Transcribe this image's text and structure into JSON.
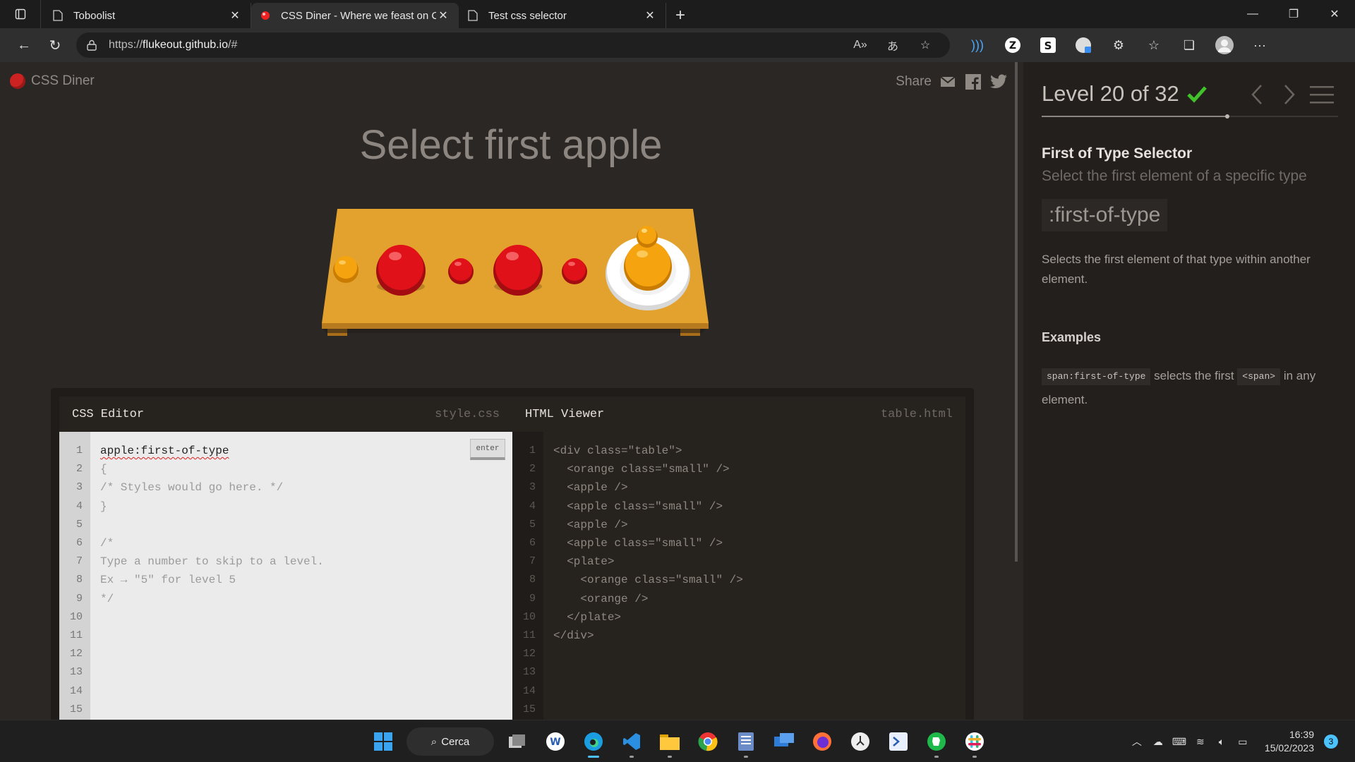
{
  "browser": {
    "tabs": [
      {
        "title": "Toboolist",
        "icon": "page-icon"
      },
      {
        "title": "CSS Diner - Where we feast on C",
        "icon": "css-diner-icon"
      },
      {
        "title": "Test css selector",
        "icon": "page-icon"
      }
    ],
    "url_prefix": "https://",
    "url_host": "flukeout.github.io",
    "url_suffix": "/#"
  },
  "page": {
    "logo": "CSS Diner",
    "share_label": "Share",
    "instruction": "Select first apple"
  },
  "editor": {
    "css_label": "CSS Editor",
    "css_file": "style.css",
    "html_label": "HTML Viewer",
    "html_file": "table.html",
    "enter_label": "enter",
    "typed_selector": "apple:first-of-type",
    "line_numbers": "1\n2\n3\n4\n5\n6\n7\n8\n9\n10\n11\n12\n13\n14\n15",
    "css_rest": "\n{\n/* Styles would go here. */\n}\n\n/*\nType a number to skip to a level.\nEx → \"5\" for level 5\n*/",
    "html_code": "<div class=\"table\">\n  <orange class=\"small\" />\n  <apple />\n  <apple class=\"small\" />\n  <apple />\n  <apple class=\"small\" />\n  <plate>\n    <orange class=\"small\" />\n    <orange />\n  </plate>\n</div>"
  },
  "sidebar": {
    "level_title": "Level 20 of 32",
    "level_current": 20,
    "level_total": 32,
    "completed": true,
    "selector_name": "First of Type Selector",
    "selector_title": "Select the first element of a specific type",
    "syntax": ":first-of-type",
    "hint": "Selects the first element of that type within another element.",
    "examples_heading": "Examples",
    "example_code": "span:first-of-type",
    "example_text_1": "selects the first",
    "example_tag": "<span>",
    "example_text_2": "in any element."
  },
  "taskbar": {
    "search_label": "Cerca",
    "time": "16:39",
    "date": "15/02/2023",
    "notifications": "3"
  },
  "colors": {
    "accent_green": "#41c12a",
    "apple_red": "#d8101a",
    "orange": "#f2a10f",
    "table_wood": "#e3a22e"
  }
}
